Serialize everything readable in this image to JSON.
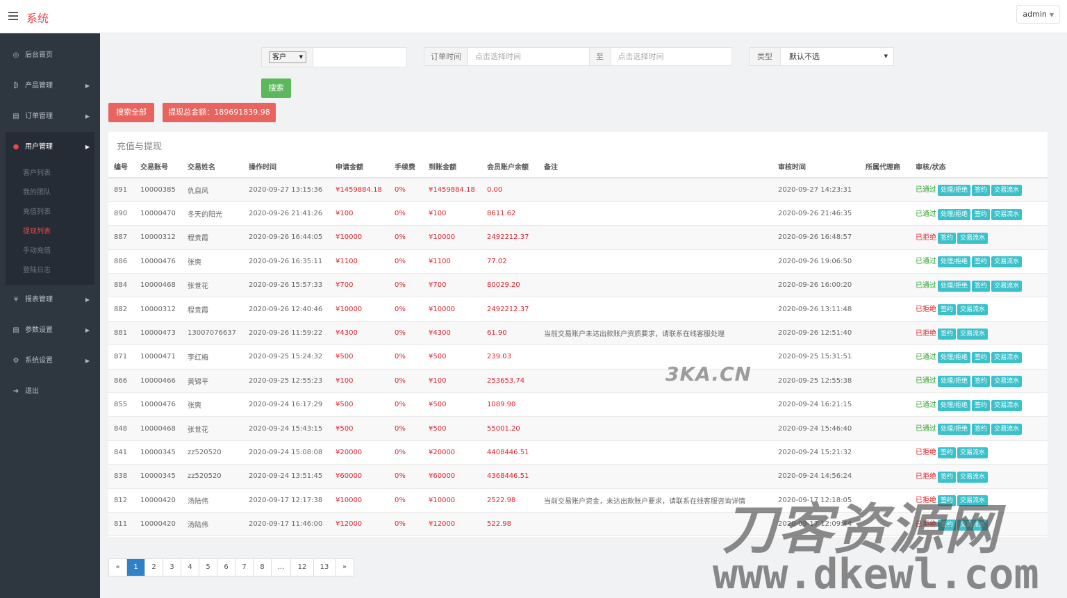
{
  "app": {
    "title": "系统",
    "user": "admin"
  },
  "sidebar": {
    "items": [
      {
        "label": "后台首页",
        "icon": "dashboard-icon",
        "glyph": "◎"
      },
      {
        "label": "产品管理",
        "icon": "bitcoin-icon",
        "glyph": "₿"
      },
      {
        "label": "订单管理",
        "icon": "copy-icon",
        "glyph": "▤"
      },
      {
        "label": "用户管理",
        "icon": "user-icon",
        "glyph": "●"
      },
      {
        "label": "报表管理",
        "icon": "yen-icon",
        "glyph": "¥"
      },
      {
        "label": "参数设置",
        "icon": "copy-icon",
        "glyph": "▤"
      },
      {
        "label": "系统设置",
        "icon": "gears-icon",
        "glyph": "⚙"
      },
      {
        "label": "退出",
        "icon": "signout-icon",
        "glyph": "➜"
      }
    ],
    "submenu": [
      "客户列表",
      "我的团队",
      "充值列表",
      "提现列表",
      "手动充值",
      "登陆日志"
    ]
  },
  "filter": {
    "customer_select": "客户",
    "customer_value": "",
    "order_time_label": "订单时间",
    "start_placeholder": "点击选择时间",
    "to_label": "至",
    "end_placeholder": "点击选择时间",
    "type_label": "类型",
    "type_value": "默认不选",
    "search_btn": "搜索",
    "search_all_btn": "搜索全部",
    "total_label": "提现总金额：189691839.98"
  },
  "panel": {
    "title": "充值与提现",
    "columns": [
      "编号",
      "交易账号",
      "交易姓名",
      "操作时间",
      "申请金额",
      "手续费",
      "到账金额",
      "会员账户余额",
      "备注",
      "审核时间",
      "所属代理商",
      "审核/状态"
    ],
    "rows": [
      [
        "891",
        "10000385",
        "仇自风",
        "2020-09-27 13:15:36",
        "¥1459884.18",
        "0%",
        "¥1459884.18",
        "0.00",
        "",
        "2020-09-27 14:23:31",
        "",
        "已通过"
      ],
      [
        "890",
        "10000470",
        "冬天的阳光",
        "2020-09-26 21:41:26",
        "¥100",
        "0%",
        "¥100",
        "8611.62",
        "",
        "2020-09-26 21:46:35",
        "",
        "已通过"
      ],
      [
        "887",
        "10000312",
        "程贵霞",
        "2020-09-26 16:44:05",
        "¥10000",
        "0%",
        "¥10000",
        "2492212.37",
        "",
        "2020-09-26 16:48:57",
        "",
        "已拒绝"
      ],
      [
        "886",
        "10000476",
        "张爽",
        "2020-09-26 16:35:11",
        "¥1100",
        "0%",
        "¥1100",
        "77.02",
        "",
        "2020-09-26 19:06:50",
        "",
        "已通过"
      ],
      [
        "884",
        "10000468",
        "张世花",
        "2020-09-26 15:57:33",
        "¥700",
        "0%",
        "¥700",
        "80029.20",
        "",
        "2020-09-26 16:00:20",
        "",
        "已通过"
      ],
      [
        "882",
        "10000312",
        "程贵霞",
        "2020-09-26 12:40:46",
        "¥10000",
        "0%",
        "¥10000",
        "2492212.37",
        "",
        "2020-09-26 13:11:48",
        "",
        "已拒绝"
      ],
      [
        "881",
        "10000473",
        "13007076637",
        "2020-09-26 11:59:22",
        "¥4300",
        "0%",
        "¥4300",
        "61.90",
        "当前交易账户未达出款账户资质要求，请联系在线客服处理",
        "2020-09-26 12:51:40",
        "",
        "已拒绝"
      ],
      [
        "871",
        "10000471",
        "李红梅",
        "2020-09-25 15:24:32",
        "¥500",
        "0%",
        "¥500",
        "239.03",
        "",
        "2020-09-25 15:31:51",
        "",
        "已通过"
      ],
      [
        "866",
        "10000466",
        "黄锦平",
        "2020-09-25 12:55:23",
        "¥100",
        "0%",
        "¥100",
        "253653.74",
        "",
        "2020-09-25 12:55:38",
        "",
        "已通过"
      ],
      [
        "855",
        "10000476",
        "张爽",
        "2020-09-24 16:17:29",
        "¥500",
        "0%",
        "¥500",
        "1089.90",
        "",
        "2020-09-24 16:21:15",
        "",
        "已通过"
      ],
      [
        "848",
        "10000468",
        "张世花",
        "2020-09-24 15:43:15",
        "¥500",
        "0%",
        "¥500",
        "55001.20",
        "",
        "2020-09-24 15:46:40",
        "",
        "已通过"
      ],
      [
        "841",
        "10000345",
        "zz520520",
        "2020-09-24 15:08:08",
        "¥20000",
        "0%",
        "¥20000",
        "4408446.51",
        "",
        "2020-09-24 15:21:32",
        "",
        "已拒绝"
      ],
      [
        "838",
        "10000345",
        "zz520520",
        "2020-09-24 13:51:45",
        "¥60000",
        "0%",
        "¥60000",
        "4368446.51",
        "",
        "2020-09-24 14:56:24",
        "",
        "已拒绝"
      ],
      [
        "812",
        "10000420",
        "汤陆伟",
        "2020-09-17 12:17:38",
        "¥10000",
        "0%",
        "¥10000",
        "2522.98",
        "当前交易账户资金，未达出款账户要求，请联系在线客服咨询详情",
        "2020-09-17 12:18:05",
        "",
        "已拒绝"
      ],
      [
        "811",
        "10000420",
        "汤陆伟",
        "2020-09-17 11:46:00",
        "¥12000",
        "0%",
        "¥12000",
        "522.98",
        "",
        "2020-09-17 12:09:44",
        "",
        "已拒绝"
      ]
    ],
    "btn_process": "处理/拒绝",
    "btn_sign": "签约",
    "btn_flow": "交易流水",
    "status_pass": "已通过"
  },
  "pagination": [
    "«",
    "1",
    "2",
    "3",
    "4",
    "5",
    "6",
    "7",
    "8",
    "...",
    "12",
    "13",
    "»"
  ],
  "pagination_active": "1",
  "watermarks": [
    "3KA.CN",
    "刀客资源网",
    "www.dkewl.com"
  ],
  "colors": {
    "brand": "#e8464a",
    "sidebar": "#2e3640",
    "success": "#5cb85c",
    "danger": "#e9635f",
    "info": "#3cc1cb",
    "primary": "#2f82c8"
  }
}
